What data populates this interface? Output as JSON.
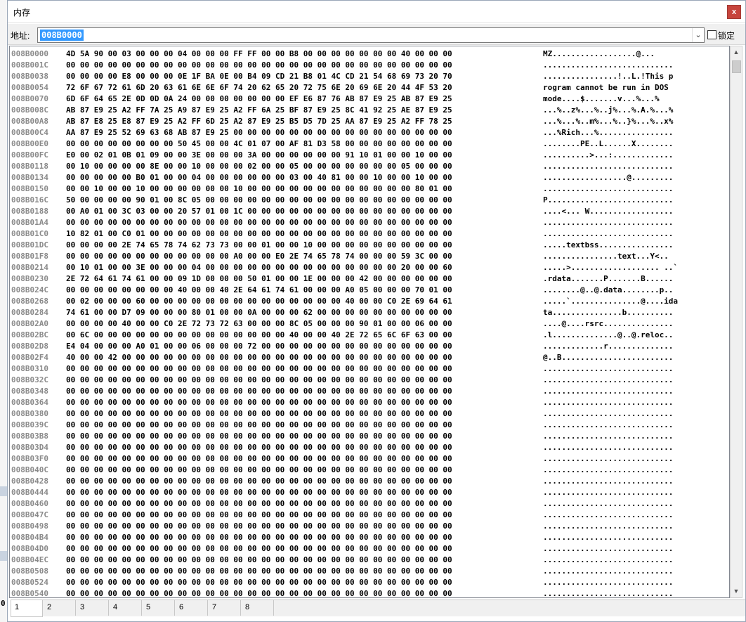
{
  "window": {
    "title": "内存",
    "close_label": "x"
  },
  "address_bar": {
    "label": "地址:",
    "value": "008B0000",
    "lock_label": "锁定",
    "lock_checked": false
  },
  "side_label": "0",
  "colors": {
    "address_text": "#8a8a8a",
    "selection": "#3399ff",
    "close_button": "#c7453d"
  },
  "memory": {
    "rows": [
      {
        "addr": "008B0000",
        "hex": "4D 5A 90 00 03 00 00 00 04 00 00 00 FF FF 00 00 B8 00 00 00 00 00 00 00 40 00 00 00",
        "ascii": "MZ..................@..."
      },
      {
        "addr": "008B001C",
        "hex": "00 00 00 00 00 00 00 00 00 00 00 00 00 00 00 00 00 00 00 00 00 00 00 00 00 00 00 00",
        "ascii": "............................"
      },
      {
        "addr": "008B0038",
        "hex": "00 00 00 00 E8 00 00 00 0E 1F BA 0E 00 B4 09 CD 21 B8 01 4C CD 21 54 68 69 73 20 70",
        "ascii": "................!..L.!This p"
      },
      {
        "addr": "008B0054",
        "hex": "72 6F 67 72 61 6D 20 63 61 6E 6E 6F 74 20 62 65 20 72 75 6E 20 69 6E 20 44 4F 53 20",
        "ascii": "rogram cannot be run in DOS "
      },
      {
        "addr": "008B0070",
        "hex": "6D 6F 64 65 2E 0D 0D 0A 24 00 00 00 00 00 00 00 EF E6 87 76 AB 87 E9 25 AB 87 E9 25",
        "ascii": "mode....$.......v...%...%"
      },
      {
        "addr": "008B008C",
        "hex": "AB 87 E9 25 A2 FF 7A 25 A9 87 E9 25 A2 FF 6A 25 BF 87 E9 25 8C 41 92 25 AE 87 E9 25",
        "ascii": "...%..z%...%..j%...%.A.%...%"
      },
      {
        "addr": "008B00A8",
        "hex": "AB 87 E8 25 E8 87 E9 25 A2 FF 6D 25 A2 87 E9 25 B5 D5 7D 25 AA 87 E9 25 A2 FF 78 25",
        "ascii": "...%...%..m%...%..}%...%..x%"
      },
      {
        "addr": "008B00C4",
        "hex": "AA 87 E9 25 52 69 63 68 AB 87 E9 25 00 00 00 00 00 00 00 00 00 00 00 00 00 00 00 00",
        "ascii": "...%Rich...%................"
      },
      {
        "addr": "008B00E0",
        "hex": "00 00 00 00 00 00 00 00 50 45 00 00 4C 01 07 00 AF 81 D3 58 00 00 00 00 00 00 00 00",
        "ascii": "........PE..L......X........"
      },
      {
        "addr": "008B00FC",
        "hex": "E0 00 02 01 0B 01 09 00 00 3E 00 00 00 3A 00 00 00 00 00 00 91 10 01 00 00 10 00 00",
        "ascii": "..........>...:............."
      },
      {
        "addr": "008B0118",
        "hex": "00 10 00 00 00 00 8E 00 00 10 00 00 00 02 00 00 05 00 00 00 00 00 00 00 05 00 00 00",
        "ascii": "............................"
      },
      {
        "addr": "008B0134",
        "hex": "00 00 00 00 00 B0 01 00 00 04 00 00 00 00 00 00 03 00 40 81 00 00 10 00 00 10 00 00",
        "ascii": "..................@........."
      },
      {
        "addr": "008B0150",
        "hex": "00 00 10 00 00 10 00 00 00 00 00 00 10 00 00 00 00 00 00 00 00 00 00 00 00 80 01 00",
        "ascii": "............................"
      },
      {
        "addr": "008B016C",
        "hex": "50 00 00 00 00 90 01 00 8C 05 00 00 00 00 00 00 00 00 00 00 00 00 00 00 00 00 00 00",
        "ascii": "P..........................."
      },
      {
        "addr": "008B0188",
        "hex": "00 A0 01 00 3C 03 00 00 20 57 01 00 1C 00 00 00 00 00 00 00 00 00 00 00 00 00 00 00",
        "ascii": "....<... W.................."
      },
      {
        "addr": "008B01A4",
        "hex": "00 00 00 00 00 00 00 00 00 00 00 00 00 00 00 00 00 00 00 00 00 00 00 00 00 00 00 00",
        "ascii": "............................"
      },
      {
        "addr": "008B01C0",
        "hex": "10 82 01 00 C0 01 00 00 00 00 00 00 00 00 00 00 00 00 00 00 00 00 00 00 00 00 00 00",
        "ascii": "............................"
      },
      {
        "addr": "008B01DC",
        "hex": "00 00 00 00 2E 74 65 78 74 62 73 73 00 00 01 00 00 10 00 00 00 00 00 00 00 00 00 00",
        "ascii": ".....textbss................"
      },
      {
        "addr": "008B01F8",
        "hex": "00 00 00 00 00 00 00 00 00 00 00 00 A0 00 00 E0 2E 74 65 78 74 00 00 00 59 3C 00 00",
        "ascii": "................text...Y<.."
      },
      {
        "addr": "008B0214",
        "hex": "00 10 01 00 00 3E 00 00 00 04 00 00 00 00 00 00 00 00 00 00 00 00 00 00 20 00 00 60",
        "ascii": ".....>................... ..`"
      },
      {
        "addr": "008B0230",
        "hex": "2E 72 64 61 74 61 00 00 09 1D 00 00 00 50 01 00 00 1E 00 00 00 42 00 00 00 00 00 00",
        "ascii": ".rdata.......P.......B......"
      },
      {
        "addr": "008B024C",
        "hex": "00 00 00 00 00 00 00 00 40 00 00 40 2E 64 61 74 61 00 00 00 A0 05 00 00 00 70 01 00",
        "ascii": "........@..@.data........p.."
      },
      {
        "addr": "008B0268",
        "hex": "00 02 00 00 00 60 00 00 00 00 00 00 00 00 00 00 00 00 00 00 40 00 00 C0 2E 69 64 61",
        "ascii": ".....`...............@....ida"
      },
      {
        "addr": "008B0284",
        "hex": "74 61 00 00 D7 09 00 00 00 80 01 00 00 0A 00 00 00 62 00 00 00 00 00 00 00 00 00 00",
        "ascii": "ta...............b.........."
      },
      {
        "addr": "008B02A0",
        "hex": "00 00 00 00 40 00 00 C0 2E 72 73 72 63 00 00 00 8C 05 00 00 00 90 01 00 00 06 00 00",
        "ascii": "....@....rsrc..............."
      },
      {
        "addr": "008B02BC",
        "hex": "00 6C 00 00 00 00 00 00 00 00 00 00 00 00 00 00 40 00 00 40 2E 72 65 6C 6F 63 00 00",
        "ascii": ".l..............@..@.reloc.."
      },
      {
        "addr": "008B02D8",
        "hex": "E4 04 00 00 00 A0 01 00 00 06 00 00 00 72 00 00 00 00 00 00 00 00 00 00 00 00 00 00",
        "ascii": ".............r.............."
      },
      {
        "addr": "008B02F4",
        "hex": "40 00 00 42 00 00 00 00 00 00 00 00 00 00 00 00 00 00 00 00 00 00 00 00 00 00 00 00",
        "ascii": "@..B........................"
      },
      {
        "addr": "008B0310",
        "hex": "00 00 00 00 00 00 00 00 00 00 00 00 00 00 00 00 00 00 00 00 00 00 00 00 00 00 00 00",
        "ascii": "............................"
      },
      {
        "addr": "008B032C",
        "hex": "00 00 00 00 00 00 00 00 00 00 00 00 00 00 00 00 00 00 00 00 00 00 00 00 00 00 00 00",
        "ascii": "............................"
      },
      {
        "addr": "008B0348",
        "hex": "00 00 00 00 00 00 00 00 00 00 00 00 00 00 00 00 00 00 00 00 00 00 00 00 00 00 00 00",
        "ascii": "............................"
      },
      {
        "addr": "008B0364",
        "hex": "00 00 00 00 00 00 00 00 00 00 00 00 00 00 00 00 00 00 00 00 00 00 00 00 00 00 00 00",
        "ascii": "............................"
      },
      {
        "addr": "008B0380",
        "hex": "00 00 00 00 00 00 00 00 00 00 00 00 00 00 00 00 00 00 00 00 00 00 00 00 00 00 00 00",
        "ascii": "............................"
      },
      {
        "addr": "008B039C",
        "hex": "00 00 00 00 00 00 00 00 00 00 00 00 00 00 00 00 00 00 00 00 00 00 00 00 00 00 00 00",
        "ascii": "............................"
      },
      {
        "addr": "008B03B8",
        "hex": "00 00 00 00 00 00 00 00 00 00 00 00 00 00 00 00 00 00 00 00 00 00 00 00 00 00 00 00",
        "ascii": "............................"
      },
      {
        "addr": "008B03D4",
        "hex": "00 00 00 00 00 00 00 00 00 00 00 00 00 00 00 00 00 00 00 00 00 00 00 00 00 00 00 00",
        "ascii": "............................"
      },
      {
        "addr": "008B03F0",
        "hex": "00 00 00 00 00 00 00 00 00 00 00 00 00 00 00 00 00 00 00 00 00 00 00 00 00 00 00 00",
        "ascii": "............................"
      },
      {
        "addr": "008B040C",
        "hex": "00 00 00 00 00 00 00 00 00 00 00 00 00 00 00 00 00 00 00 00 00 00 00 00 00 00 00 00",
        "ascii": "............................"
      },
      {
        "addr": "008B0428",
        "hex": "00 00 00 00 00 00 00 00 00 00 00 00 00 00 00 00 00 00 00 00 00 00 00 00 00 00 00 00",
        "ascii": "............................"
      },
      {
        "addr": "008B0444",
        "hex": "00 00 00 00 00 00 00 00 00 00 00 00 00 00 00 00 00 00 00 00 00 00 00 00 00 00 00 00",
        "ascii": "............................"
      },
      {
        "addr": "008B0460",
        "hex": "00 00 00 00 00 00 00 00 00 00 00 00 00 00 00 00 00 00 00 00 00 00 00 00 00 00 00 00",
        "ascii": "............................"
      },
      {
        "addr": "008B047C",
        "hex": "00 00 00 00 00 00 00 00 00 00 00 00 00 00 00 00 00 00 00 00 00 00 00 00 00 00 00 00",
        "ascii": "............................"
      },
      {
        "addr": "008B0498",
        "hex": "00 00 00 00 00 00 00 00 00 00 00 00 00 00 00 00 00 00 00 00 00 00 00 00 00 00 00 00",
        "ascii": "............................"
      },
      {
        "addr": "008B04B4",
        "hex": "00 00 00 00 00 00 00 00 00 00 00 00 00 00 00 00 00 00 00 00 00 00 00 00 00 00 00 00",
        "ascii": "............................"
      },
      {
        "addr": "008B04D0",
        "hex": "00 00 00 00 00 00 00 00 00 00 00 00 00 00 00 00 00 00 00 00 00 00 00 00 00 00 00 00",
        "ascii": "............................"
      },
      {
        "addr": "008B04EC",
        "hex": "00 00 00 00 00 00 00 00 00 00 00 00 00 00 00 00 00 00 00 00 00 00 00 00 00 00 00 00",
        "ascii": "............................"
      },
      {
        "addr": "008B0508",
        "hex": "00 00 00 00 00 00 00 00 00 00 00 00 00 00 00 00 00 00 00 00 00 00 00 00 00 00 00 00",
        "ascii": "............................"
      },
      {
        "addr": "008B0524",
        "hex": "00 00 00 00 00 00 00 00 00 00 00 00 00 00 00 00 00 00 00 00 00 00 00 00 00 00 00 00",
        "ascii": "............................"
      },
      {
        "addr": "008B0540",
        "hex": "00 00 00 00 00 00 00 00 00 00 00 00 00 00 00 00 00 00 00 00 00 00 00 00 00 00 00 00",
        "ascii": "............................"
      }
    ]
  },
  "tabs": [
    {
      "label": "1",
      "active": true
    },
    {
      "label": "2",
      "active": false
    },
    {
      "label": "3",
      "active": false
    },
    {
      "label": "4",
      "active": false
    },
    {
      "label": "5",
      "active": false
    },
    {
      "label": "6",
      "active": false
    },
    {
      "label": "7",
      "active": false
    },
    {
      "label": "8",
      "active": false
    }
  ]
}
